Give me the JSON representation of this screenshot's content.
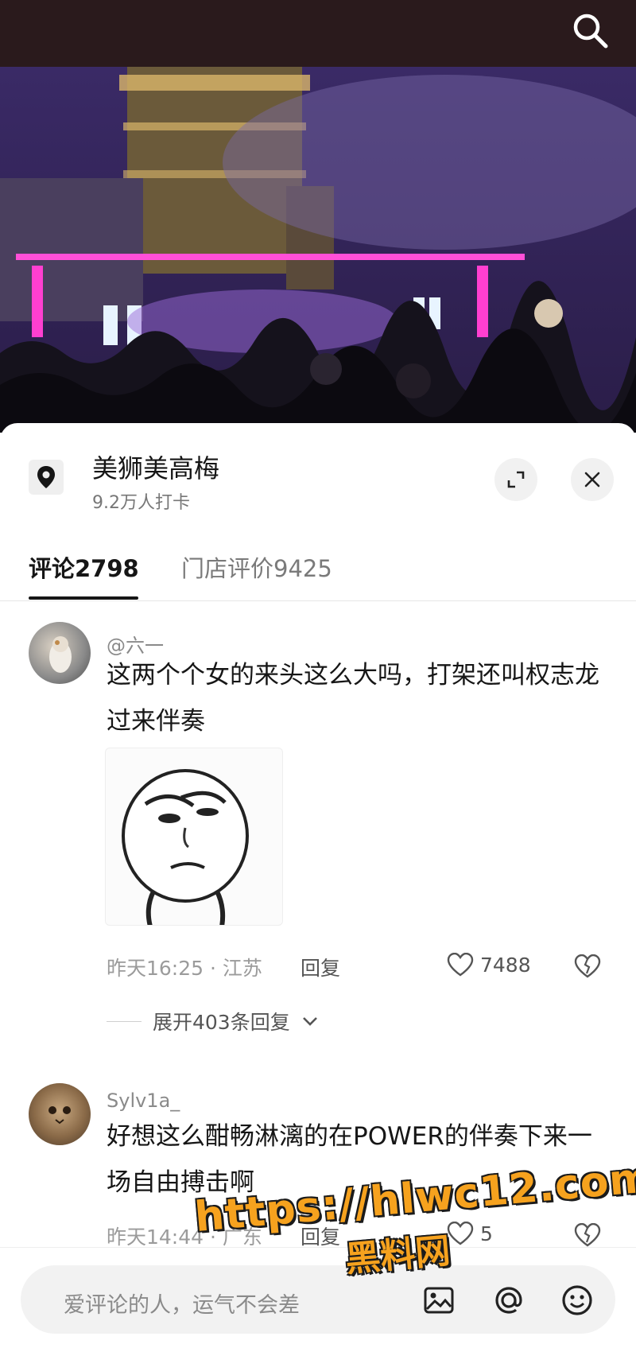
{
  "location": {
    "name": "美狮美高梅",
    "checkins": "9.2万人打卡"
  },
  "tabs": [
    {
      "label": "评论2798",
      "active": true
    },
    {
      "label": "门店评价9425",
      "active": false
    }
  ],
  "comments": [
    {
      "user": "@六一",
      "text": "这两个个女的来头这么大吗，打架还叫权志龙过来伴奏",
      "has_sticker": true,
      "time_location": "昨天16:25 · 江苏",
      "reply_label": "回复",
      "likes": "7488",
      "expand_label": "展开403条回复"
    },
    {
      "user": "Sylv1a_",
      "text": "好想这么酣畅淋漓的在POWER的伴奏下来一场自由搏击啊",
      "time_location": "昨天14:44 · 广东",
      "reply_label": "回复",
      "likes": "5"
    }
  ],
  "input": {
    "placeholder": "爱评论的人，运气不会差"
  },
  "watermark": {
    "url": "https://hlwc12.com",
    "name": "黑料网"
  },
  "icons": [
    "search-icon",
    "location-pin-icon",
    "expand-icon",
    "close-icon",
    "heart-icon",
    "broken-heart-icon",
    "chevron-down-icon",
    "image-icon",
    "at-icon",
    "emoji-icon"
  ],
  "colors": {
    "topbar": "#2a1a1c",
    "text_primary": "#161616",
    "text_secondary": "#8a8a8a",
    "watermark": "#f6a21e"
  }
}
